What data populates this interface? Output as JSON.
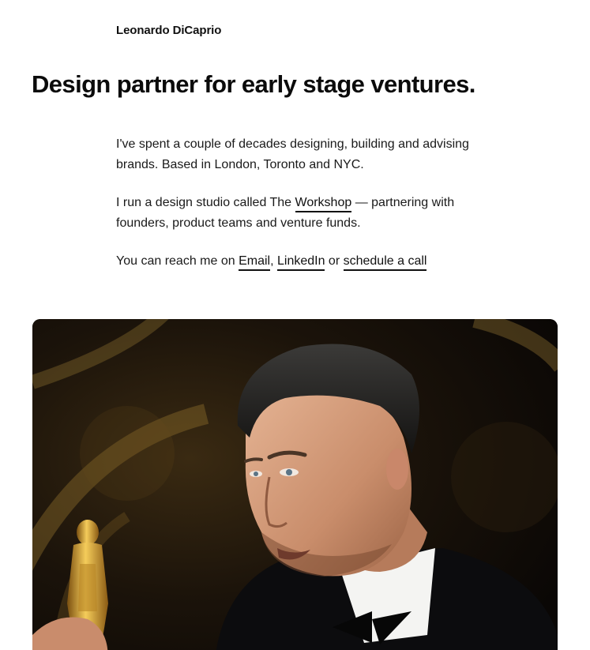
{
  "header": {
    "site_name": "Leonardo DiCaprio"
  },
  "hero": {
    "headline": "Design partner for early stage ventures."
  },
  "bio": {
    "p1": "I've spent a couple of decades designing, building and advising brands. Based in London, Toronto and NYC.",
    "p2_before": "I run a design studio called The ",
    "p2_link": "Workshop",
    "p2_after": " — partnering with founders, product teams and venture funds.",
    "p3_before": "You can reach me on ",
    "p3_email": "Email",
    "p3_sep": ", ",
    "p3_linkedin": "LinkedIn",
    "p3_or": " or ",
    "p3_call": "schedule a call"
  },
  "photo": {
    "alt": "Portrait photo holding a golden statuette"
  }
}
